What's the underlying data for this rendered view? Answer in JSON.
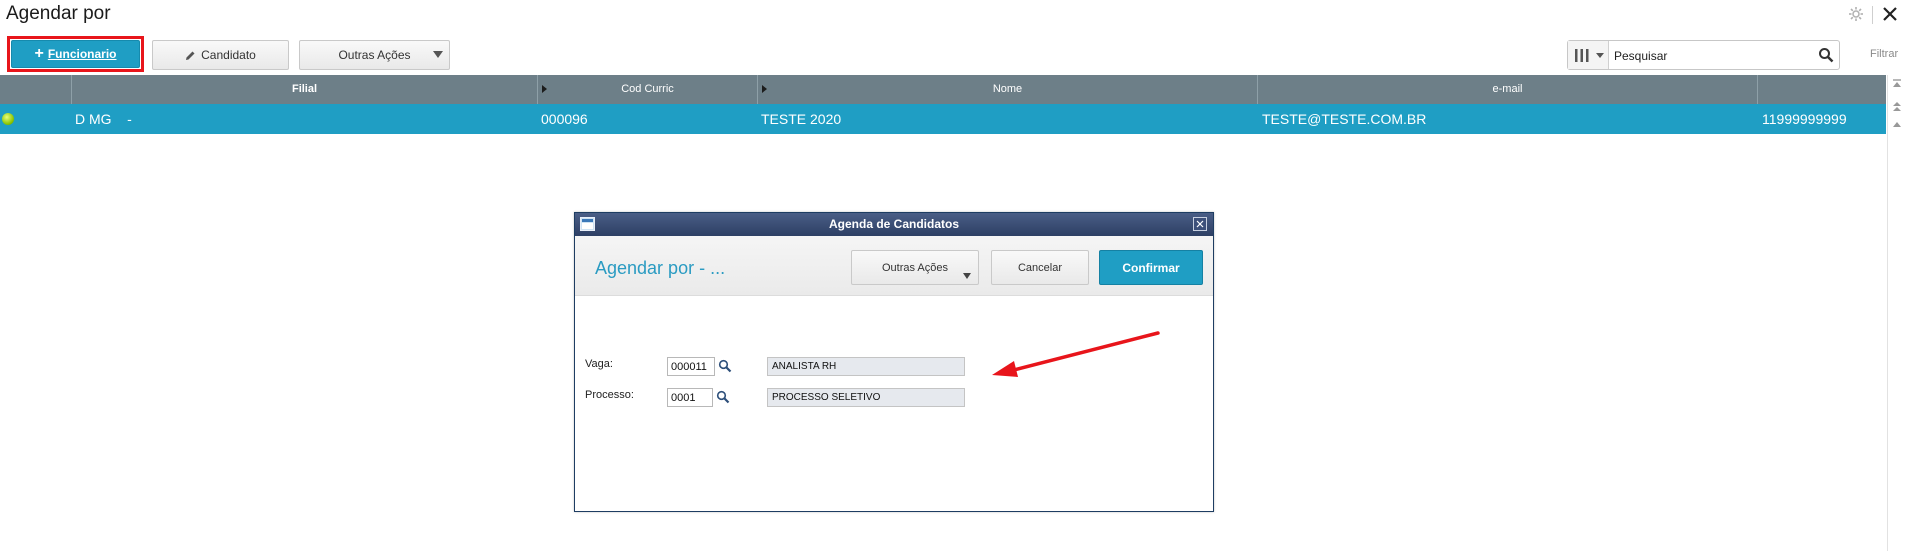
{
  "window": {
    "title": "Agendar por"
  },
  "toolbar": {
    "funcionario_label": "Funcionario",
    "candidato_label": "Candidato",
    "outras_acoes_label": "Outras Ações"
  },
  "search": {
    "value": "Pesquisar",
    "filter_label": "Filtrar"
  },
  "table": {
    "columns": [
      "",
      "Filial",
      "Cod Curric",
      "Nome",
      "e-mail",
      ""
    ],
    "rows": [
      {
        "status": "active",
        "filial": "D MG    -",
        "cod_curric": "000096",
        "nome": "TESTE 2020",
        "email": "TESTE@TESTE.COM.BR",
        "telefone": "11999999999"
      }
    ]
  },
  "modal": {
    "title": "Agenda de Candidatos",
    "heading": "Agendar por - ...",
    "outras_acoes_label": "Outras Ações",
    "cancel_label": "Cancelar",
    "confirm_label": "Confirmar",
    "fields": {
      "vaga": {
        "label": "Vaga:",
        "code": "000011",
        "description": "ANALISTA RH"
      },
      "processo": {
        "label": "Processo:",
        "code": "0001",
        "description": "PROCESSO SELETIVO"
      }
    }
  },
  "colors": {
    "accent": "#1f9ec4",
    "header_bg": "#6d7f88",
    "modal_title_bg": "#2d3f64",
    "highlight": "#e8151b",
    "annotation_arrow": "#e8151b"
  },
  "icons": [
    "settings-icon",
    "close-icon",
    "plus-icon",
    "pencil-icon",
    "chevron-down-icon",
    "columns-icon",
    "search-icon",
    "status-dot-icon",
    "scroll-top-icon",
    "scroll-up-icon",
    "window-icon",
    "lookup-icon"
  ]
}
